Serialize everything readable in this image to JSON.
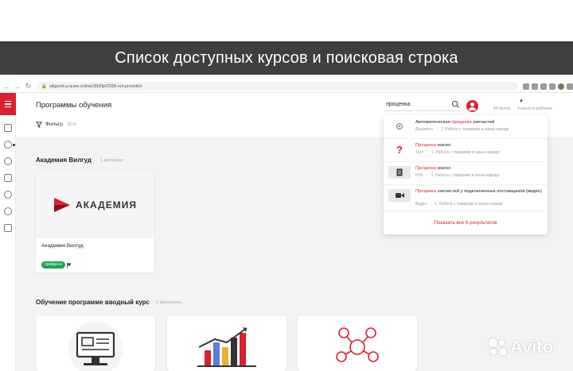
{
  "banner": {
    "title": "Список доступных курсов и поисковая строка"
  },
  "browser": {
    "url": "wilgood.a-quee.online/369/lp/3398-not-provided"
  },
  "app": {
    "page_title": "Программы обучения",
    "filter_label": "Фильтр",
    "filter_value": "Все",
    "search": {
      "query": "проценка"
    },
    "user": {
      "points": "84 балла",
      "rank": "4 место в рейтинге"
    },
    "colors": {
      "accent": "#d9222e",
      "badge": "#19a34a"
    }
  },
  "search_results": {
    "items": [
      {
        "icon": "gear-icon",
        "title_pre": "Автоматическая ",
        "title_hl": "проценка",
        "title_post": " запчастей",
        "type": "Документ",
        "path": "1. Работа с товарами в заказ-наряде"
      },
      {
        "icon": "question-icon",
        "title_pre": "",
        "title_hl": "Проценка",
        "title_post": " масел",
        "type": "Тест",
        "path": "1. Работа с товарами в заказ-наряде"
      },
      {
        "icon": "document-icon",
        "title_pre": "",
        "title_hl": "Проценка",
        "title_post": " масел",
        "type": "PDF",
        "path": "1. Работа с товарами в заказ-наряде"
      },
      {
        "icon": "video-icon",
        "title_pre": "",
        "title_hl": "Проценка",
        "title_post": " запчастей у подключенных поставщиков (видео)",
        "type": "Видео",
        "path": "1. Работа с товарами в заказ-наряде"
      }
    ],
    "show_all": "Показать все 6 результатов"
  },
  "sections": [
    {
      "title": "Академия Вилгуд",
      "count": "1 материал",
      "cards": [
        {
          "logo_text": "АКАДЕМИЯ",
          "name": "Академия Вилгуд",
          "status": "пройдено"
        }
      ]
    },
    {
      "title": "Обучение программе вводный курс",
      "count": "3 материала"
    }
  ],
  "watermark": {
    "text": "Avito"
  }
}
